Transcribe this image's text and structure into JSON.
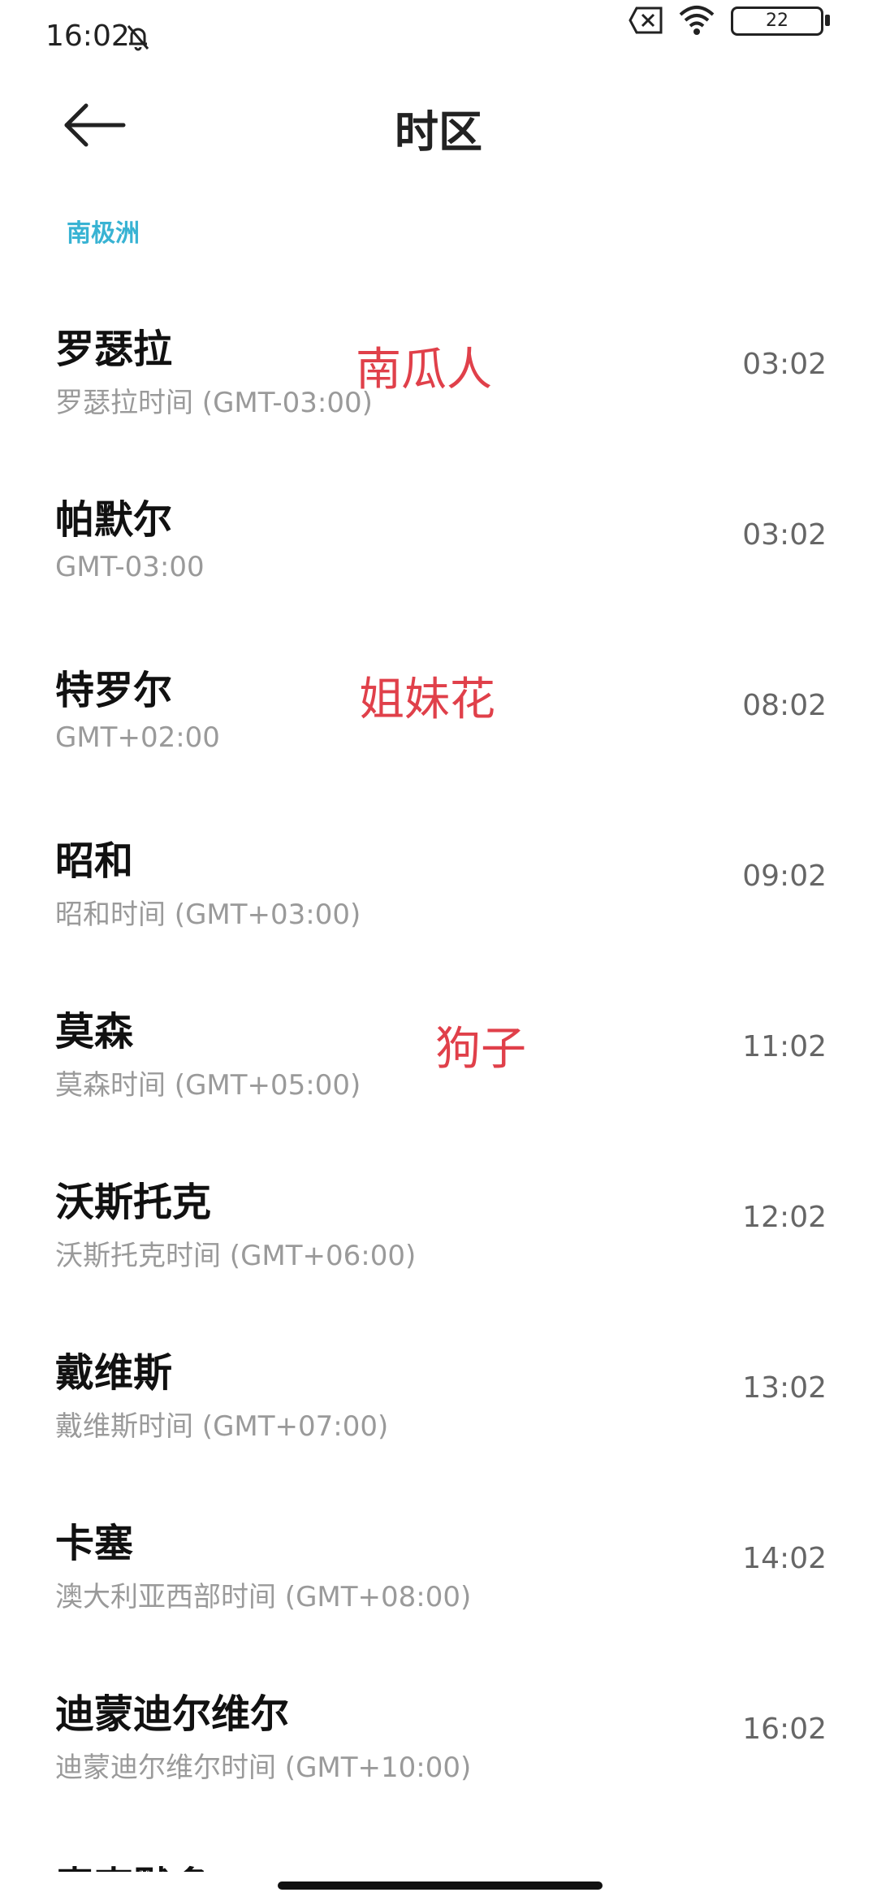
{
  "status_bar": {
    "time": "16:02",
    "battery": "22"
  },
  "header": {
    "title": "时区"
  },
  "section": "南极洲",
  "items": [
    {
      "name": "罗瑟拉",
      "desc": "罗瑟拉时间 (GMT-03:00)",
      "time": "03:02"
    },
    {
      "name": "帕默尔",
      "desc": "GMT-03:00",
      "time": "03:02"
    },
    {
      "name": "特罗尔",
      "desc": "GMT+02:00",
      "time": "08:02"
    },
    {
      "name": "昭和",
      "desc": "昭和时间 (GMT+03:00)",
      "time": "09:02"
    },
    {
      "name": "莫森",
      "desc": "莫森时间 (GMT+05:00)",
      "time": "11:02"
    },
    {
      "name": "沃斯托克",
      "desc": "沃斯托克时间 (GMT+06:00)",
      "time": "12:02"
    },
    {
      "name": "戴维斯",
      "desc": "戴维斯时间 (GMT+07:00)",
      "time": "13:02"
    },
    {
      "name": "卡塞",
      "desc": "澳大利亚西部时间 (GMT+08:00)",
      "time": "14:02"
    },
    {
      "name": "迪蒙迪尔维尔",
      "desc": "迪蒙迪尔维尔时间 (GMT+10:00)",
      "time": "16:02"
    }
  ],
  "partial_item": "麦克默多",
  "annotations": [
    "南瓜人",
    "姐妹花",
    "狗子"
  ],
  "colors": {
    "section": "#38b3d3",
    "annotation": "#e0404a"
  }
}
